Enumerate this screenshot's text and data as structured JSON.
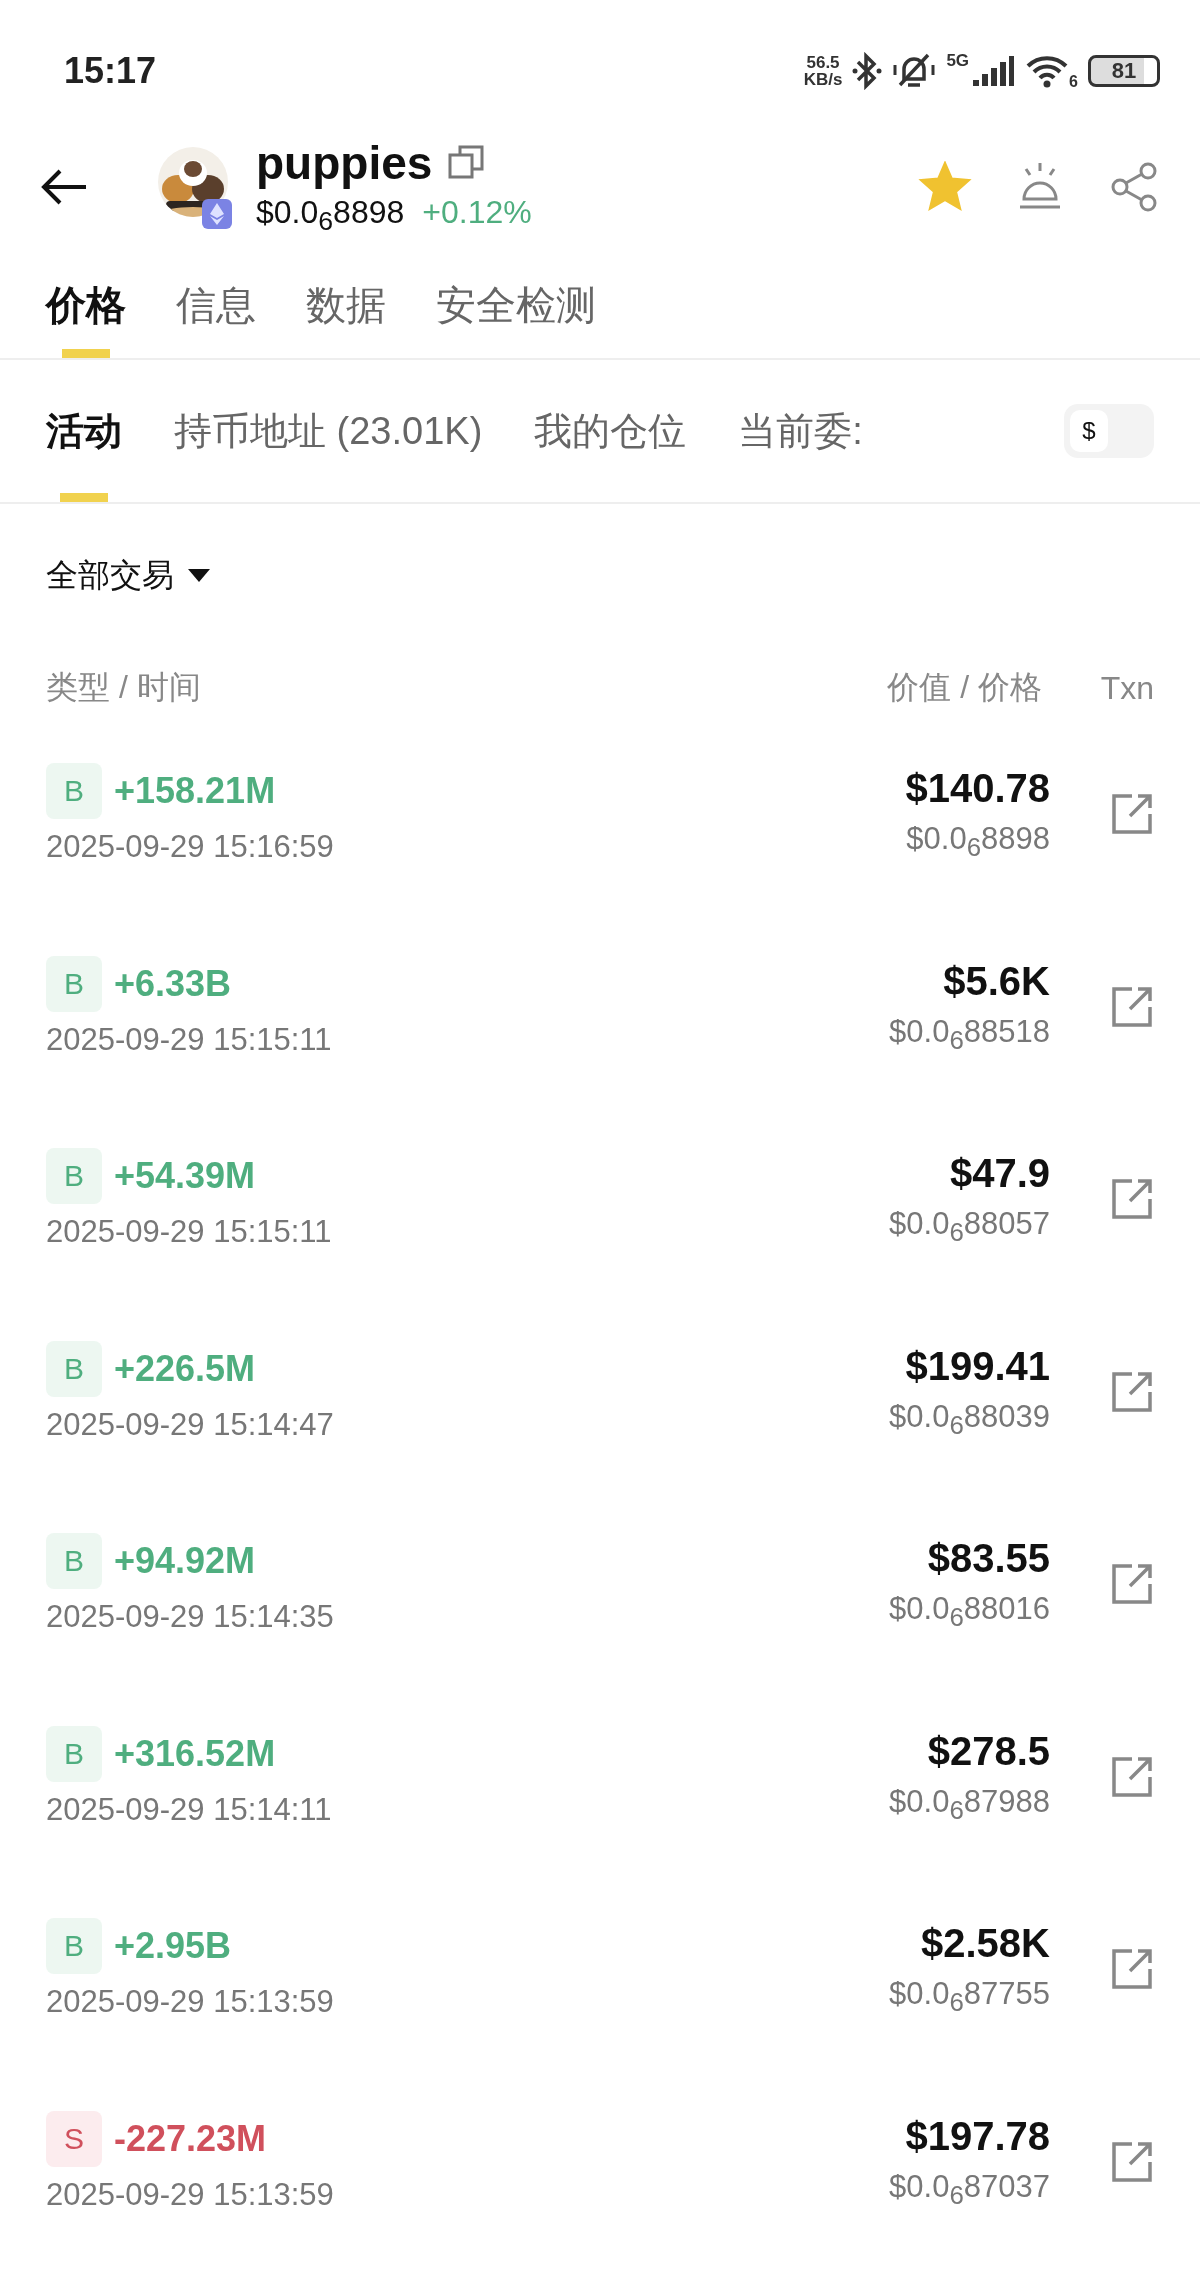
{
  "status_bar": {
    "time": "15:17",
    "speed": "56.5",
    "speed_unit": "KB/s",
    "network": "5G",
    "wifi_band": "6",
    "battery": "81"
  },
  "header": {
    "title": "puppies",
    "price": "$0.0$_{6}$8898",
    "change": "+0.12%",
    "favorite": true
  },
  "tabs": [
    {
      "label": "价格",
      "selected": true
    },
    {
      "label": "信息",
      "selected": false
    },
    {
      "label": "数据",
      "selected": false
    },
    {
      "label": "安全检测",
      "selected": false
    }
  ],
  "sub_tabs": [
    {
      "label": "活动",
      "selected": true
    },
    {
      "label": "持币地址 (23.01K)",
      "selected": false
    },
    {
      "label": "我的仓位",
      "selected": false
    },
    {
      "label": "当前委:",
      "selected": false
    }
  ],
  "currency_toggle": "$",
  "filter": "全部交易",
  "columns": {
    "left": "类型 / 时间",
    "right": "价值 / 价格",
    "txn": "Txn"
  },
  "rows": [
    {
      "kind": "buy",
      "side": "B",
      "amount": "+158.21M",
      "time": "2025-09-29 15:16:59",
      "value": "$140.78",
      "price": "$0.0$_{6}$8898"
    },
    {
      "kind": "buy",
      "side": "B",
      "amount": "+6.33B",
      "time": "2025-09-29 15:15:11",
      "value": "$5.6K",
      "price": "$0.0$_{6}$88518"
    },
    {
      "kind": "buy",
      "side": "B",
      "amount": "+54.39M",
      "time": "2025-09-29 15:15:11",
      "value": "$47.9",
      "price": "$0.0$_{6}$88057"
    },
    {
      "kind": "buy",
      "side": "B",
      "amount": "+226.5M",
      "time": "2025-09-29 15:14:47",
      "value": "$199.41",
      "price": "$0.0$_{6}$88039"
    },
    {
      "kind": "buy",
      "side": "B",
      "amount": "+94.92M",
      "time": "2025-09-29 15:14:35",
      "value": "$83.55",
      "price": "$0.0$_{6}$88016"
    },
    {
      "kind": "buy",
      "side": "B",
      "amount": "+316.52M",
      "time": "2025-09-29 15:14:11",
      "value": "$278.5",
      "price": "$0.0$_{6}$87988"
    },
    {
      "kind": "buy",
      "side": "B",
      "amount": "+2.95B",
      "time": "2025-09-29 15:13:59",
      "value": "$2.58K",
      "price": "$0.0$_{6}$87755"
    },
    {
      "kind": "sell",
      "side": "S",
      "amount": "-227.23M",
      "time": "2025-09-29 15:13:59",
      "value": "$197.78",
      "price": "$0.0$_{6}$87037"
    }
  ]
}
